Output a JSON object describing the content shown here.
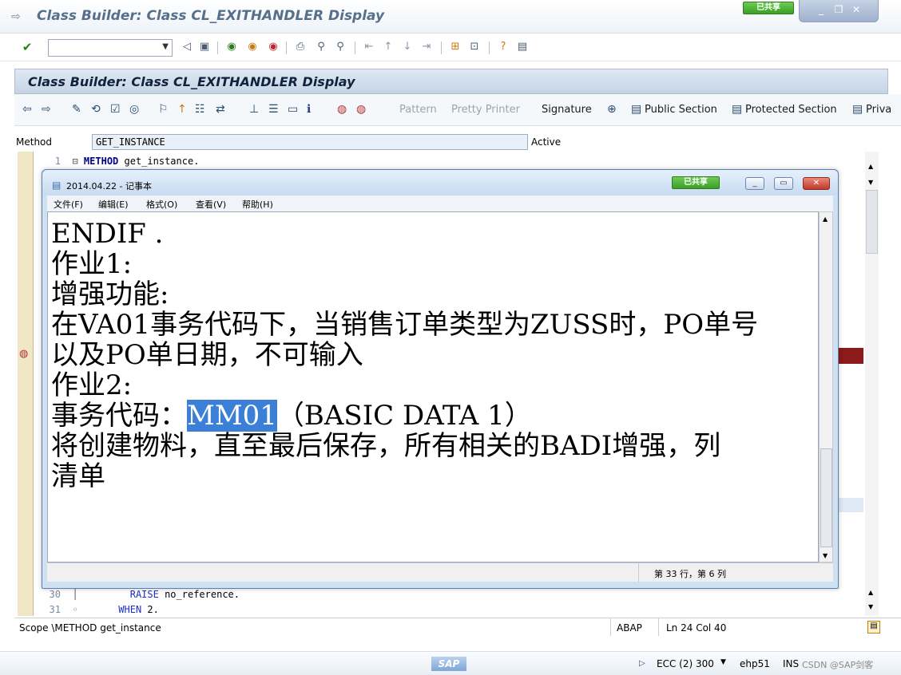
{
  "window": {
    "title": "Class Builder: Class CL_EXITHANDLER Display",
    "shared_badge": "已共享"
  },
  "system_toolbar": {
    "command_value": ""
  },
  "app": {
    "title": "Class Builder: Class CL_EXITHANDLER Display",
    "toolbar": {
      "pattern": "Pattern",
      "pretty_printer": "Pretty Printer",
      "signature": "Signature",
      "public_section": "Public Section",
      "protected_section": "Protected Section",
      "private_section": "Priva"
    }
  },
  "method_row": {
    "label": "Method",
    "value": "GET_INSTANCE",
    "status": "Active"
  },
  "code": {
    "line1_no": "1",
    "line1_kw": "METHOD",
    "line1_rest": " get_instance.",
    "line30_no": "30",
    "line30_kw": "RAISE",
    "line30_rest": " no_reference.",
    "line31_no": "31",
    "line31_kw": "WHEN",
    "line31_rest": " 2."
  },
  "status": {
    "scope": "Scope \\METHOD get_instance",
    "lang": "ABAP",
    "position": "Ln  24 Col  40"
  },
  "bottom": {
    "sap_logo": "SAP",
    "system": "ECC (2) 300",
    "host": "ehp51",
    "mode": "INS",
    "watermark": "CSDN @SAP剑客"
  },
  "notepad": {
    "title": "2014.04.22 - 记事本",
    "shared_badge": "已共享",
    "menu": [
      "文件(F)",
      "编辑(E)",
      "格式(O)",
      "查看(V)",
      "帮助(H)"
    ],
    "lines": [
      "ENDIF .",
      "",
      "作业1:",
      "增强功能:",
      "在VA01事务代码下，当销售订单类型为ZUSS时，PO单号",
      "以及PO单日期，不可输入",
      "",
      "作业2:"
    ],
    "line_mm_prefix": "事务代码：",
    "line_mm_highlight": "MM01",
    "line_mm_suffix": "（BASIC DATA 1）",
    "lines_after": [
      "将创建物料，直至最后保存，所有相关的BADI增强，列",
      "清单"
    ],
    "status": "第 33 行，第 6 列"
  }
}
